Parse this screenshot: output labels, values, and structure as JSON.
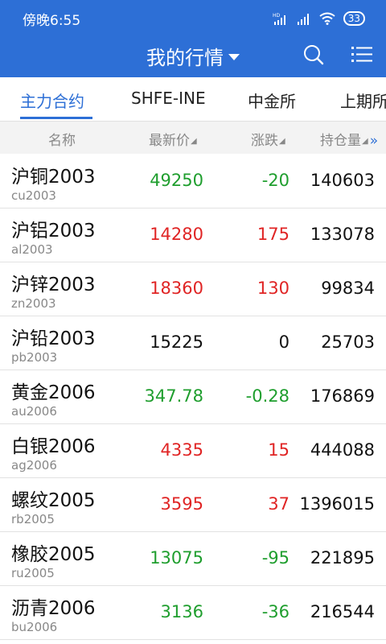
{
  "status_bar": {
    "time": "傍晚6:55",
    "battery": "33"
  },
  "app_bar": {
    "title": "我的行情"
  },
  "tabs": [
    {
      "label": "主力合约",
      "active": true
    },
    {
      "label": "SHFE-INE",
      "active": false
    },
    {
      "label": "中金所",
      "active": false
    },
    {
      "label": "上期所",
      "active": false
    }
  ],
  "table_header": {
    "name": "名称",
    "price": "最新价",
    "change": "涨跌",
    "open_interest": "持仓量",
    "more": "»"
  },
  "rows": [
    {
      "name": "沪铜2003",
      "code": "cu2003",
      "price": "49250",
      "change": "-20",
      "open_interest": "140603",
      "trend": "down"
    },
    {
      "name": "沪铝2003",
      "code": "al2003",
      "price": "14280",
      "change": "175",
      "open_interest": "133078",
      "trend": "up"
    },
    {
      "name": "沪锌2003",
      "code": "zn2003",
      "price": "18360",
      "change": "130",
      "open_interest": "99834",
      "trend": "up"
    },
    {
      "name": "沪铅2003",
      "code": "pb2003",
      "price": "15225",
      "change": "0",
      "open_interest": "25703",
      "trend": "flat"
    },
    {
      "name": "黄金2006",
      "code": "au2006",
      "price": "347.78",
      "change": "-0.28",
      "open_interest": "176869",
      "trend": "down"
    },
    {
      "name": "白银2006",
      "code": "ag2006",
      "price": "4335",
      "change": "15",
      "open_interest": "444088",
      "trend": "up"
    },
    {
      "name": "螺纹2005",
      "code": "rb2005",
      "price": "3595",
      "change": "37",
      "open_interest": "1396015",
      "trend": "up"
    },
    {
      "name": "橡胶2005",
      "code": "ru2005",
      "price": "13075",
      "change": "-95",
      "open_interest": "221895",
      "trend": "down"
    },
    {
      "name": "沥青2006",
      "code": "bu2006",
      "price": "3136",
      "change": "-36",
      "open_interest": "216544",
      "trend": "down"
    }
  ],
  "colors": {
    "primary": "#2d6fd6",
    "up": "#e02424",
    "down": "#1f9e2e",
    "flat": "#111111"
  }
}
